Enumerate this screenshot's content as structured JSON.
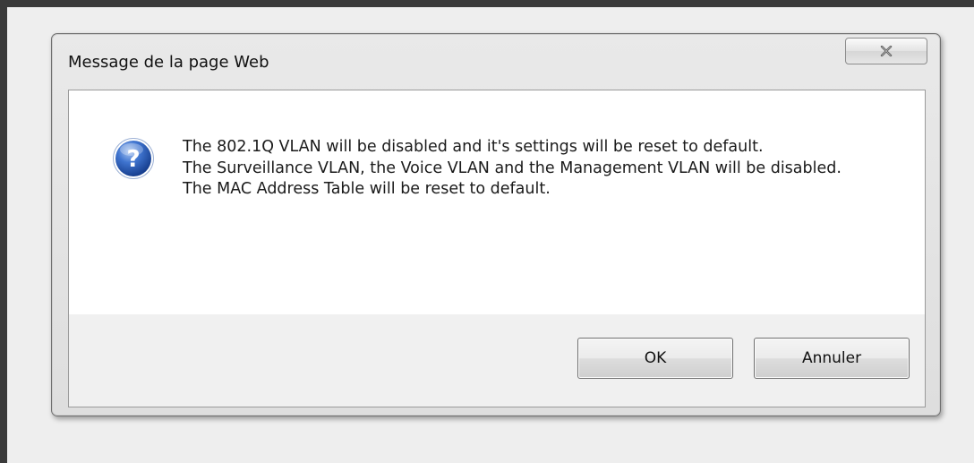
{
  "dialog": {
    "title": "Message de la page Web",
    "close_icon": "close-icon",
    "message_icon": "question-icon",
    "message_lines": [
      "The 802.1Q VLAN will be disabled and it's settings will be reset to default.",
      "The Surveillance VLAN, the Voice VLAN and the Management VLAN will be disabled.",
      "The MAC Address Table will be reset to default."
    ],
    "buttons": {
      "ok_label": "OK",
      "cancel_label": "Annuler"
    }
  },
  "colors": {
    "icon_blue": "#2a5bb8",
    "page_border": "#3a3a3a",
    "dialog_frame": "#dedede"
  }
}
